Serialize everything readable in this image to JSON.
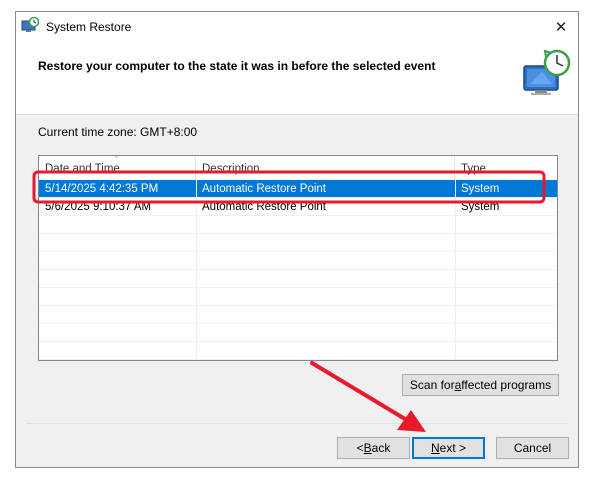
{
  "window": {
    "title": "System Restore",
    "close_glyph": "✕",
    "icon": "system-restore-icon"
  },
  "header": {
    "title": "Restore your computer to the state it was in before the selected event",
    "icon": "restore-monitor-icon"
  },
  "timezone": "Current time zone: GMT+8:00",
  "list": {
    "sort_glyph": "ˇ",
    "columns": [
      "Date and Time",
      "Description",
      "Type"
    ],
    "rows": [
      {
        "date": "5/14/2025 4:42:35 PM",
        "description": "Automatic Restore Point",
        "type": "System",
        "selected": true
      },
      {
        "date": "5/6/2025 9:10:37 AM",
        "description": "Automatic Restore Point",
        "type": "System",
        "selected": false
      }
    ]
  },
  "buttons": {
    "scan": {
      "pre": "Scan for ",
      "accel": "a",
      "post": "ffected programs"
    },
    "back": {
      "pre": "< ",
      "accel": "B",
      "post": "ack"
    },
    "next": {
      "pre": "",
      "accel": "N",
      "post": "ext >"
    },
    "cancel": {
      "label": "Cancel"
    }
  },
  "colors": {
    "selection": "#0078d7",
    "annotation": "#e8192c"
  }
}
